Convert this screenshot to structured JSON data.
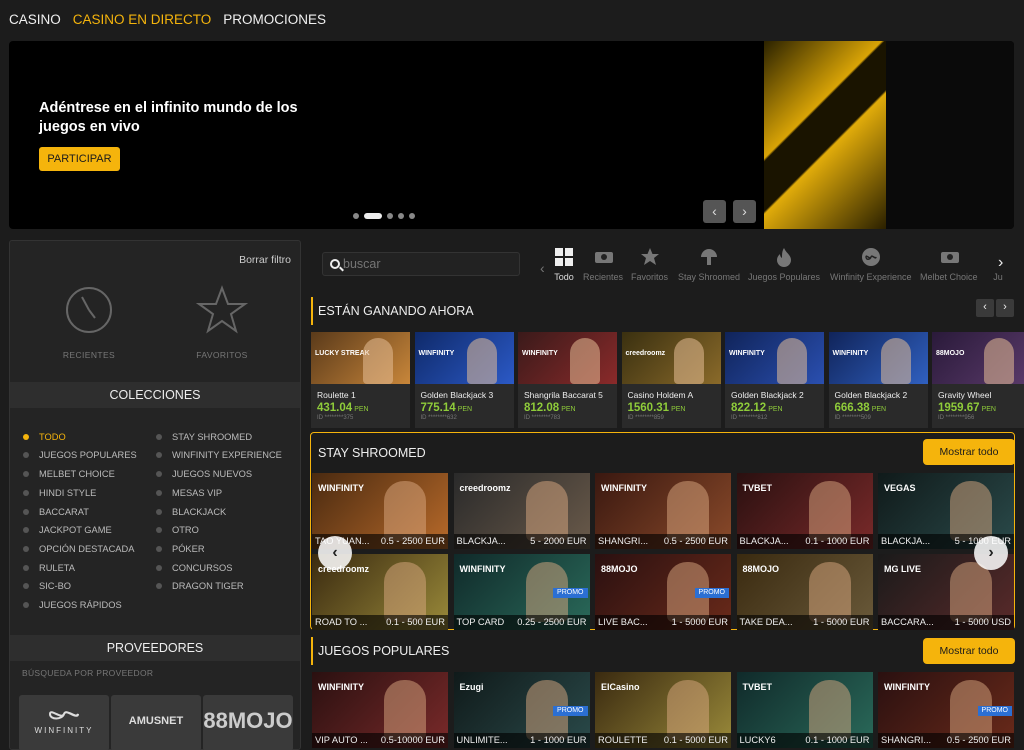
{
  "nav": [
    "CASINO",
    "CASINO EN DIRECTO",
    "PROMOCIONES"
  ],
  "hero": {
    "title": "Adéntrese en el infinito mundo de los juegos en vivo",
    "button": "PARTICIPAR"
  },
  "filters": {
    "clear": "Borrar filtro",
    "recent": "RECIENTES",
    "favorites": "FAVORITOS"
  },
  "collections": {
    "title": "COLECCIONES",
    "left": [
      "TODO",
      "JUEGOS POPULARES",
      "MELBET CHOICE",
      "HINDI STYLE",
      "BACCARAT",
      "JACKPOT GAME",
      "OPCIÓN DESTACADA",
      "RULETA",
      "SIC-BO",
      "JUEGOS RÁPIDOS"
    ],
    "right": [
      "STAY SHROOMED",
      "WINFINITY EXPERIENCE",
      "JUEGOS NUEVOS",
      "MESAS VIP",
      "BLACKJACK",
      "OTRO",
      "PÓKER",
      "CONCURSOS",
      "DRAGON TIGER"
    ]
  },
  "providers": {
    "title": "PROVEEDORES",
    "search": "BÚSQUEDA POR PROVEEDOR",
    "logos": [
      "WINFINITY",
      "AMUSNET",
      "88MOJO"
    ]
  },
  "search": {
    "placeholder": "buscar"
  },
  "categories": [
    "Todo",
    "Recientes",
    "Favoritos",
    "Stay Shroomed",
    "Juegos Populares",
    "Winfinity Experience",
    "Melbet Choice",
    "Ju"
  ],
  "winners": {
    "title": "ESTÁN GANANDO AHORA",
    "items": [
      {
        "name": "Roulette 1",
        "amount": "431.04",
        "cur": "PEN",
        "id": "ID ********375",
        "brand": "LUCKY STREAK"
      },
      {
        "name": "Golden Blackjack 3",
        "amount": "775.14",
        "cur": "PEN",
        "id": "ID ********632",
        "brand": "WINFINITY"
      },
      {
        "name": "Shangrila Baccarat 5",
        "amount": "812.08",
        "cur": "PEN",
        "id": "ID ********783",
        "brand": "WINFINITY"
      },
      {
        "name": "Casino Holdem A",
        "amount": "1560.31",
        "cur": "PEN",
        "id": "ID ********859",
        "brand": "creedroomz"
      },
      {
        "name": "Golden Blackjack 2",
        "amount": "822.12",
        "cur": "PEN",
        "id": "ID ********812",
        "brand": "WINFINITY"
      },
      {
        "name": "Golden Blackjack 2",
        "amount": "666.38",
        "cur": "PEN",
        "id": "ID ********509",
        "brand": "WINFINITY"
      },
      {
        "name": "Gravity Wheel",
        "amount": "1959.67",
        "cur": "PEN",
        "id": "ID ********956",
        "brand": "88MOJO"
      }
    ]
  },
  "stay": {
    "title": "STAY SHROOMED",
    "show_all": "Mostrar todo",
    "items": [
      {
        "name": "TAO YUAN...",
        "range": "0.5 - 2500 EUR",
        "brand": "WINFINITY",
        "badge": ""
      },
      {
        "name": "BLACKJA...",
        "range": "5 - 2000 EUR",
        "brand": "creedroomz",
        "badge": ""
      },
      {
        "name": "SHANGRI...",
        "range": "0.5 - 2500 EUR",
        "brand": "WINFINITY",
        "badge": ""
      },
      {
        "name": "BLACKJA...",
        "range": "0.1 - 1000 EUR",
        "brand": "TVBET",
        "badge": ""
      },
      {
        "name": "BLACKJA...",
        "range": "5 - 1000 EUR",
        "brand": "VEGAS",
        "badge": ""
      },
      {
        "name": "ROAD TO ...",
        "range": "0.1 - 500 EUR",
        "brand": "creedroomz",
        "badge": ""
      },
      {
        "name": "TOP CARD",
        "range": "0.25 - 2500 EUR",
        "brand": "WINFINITY",
        "badge": "PROMO"
      },
      {
        "name": "LIVE BAC...",
        "range": "1 - 5000 EUR",
        "brand": "88MOJO",
        "badge": "PROMO"
      },
      {
        "name": "TAKE DEA...",
        "range": "1 - 5000 EUR",
        "brand": "88MOJO",
        "badge": ""
      },
      {
        "name": "BACCARA...",
        "range": "1 - 5000 USD",
        "brand": "MG LIVE",
        "badge": ""
      }
    ]
  },
  "popular": {
    "title": "JUEGOS POPULARES",
    "show_all": "Mostrar todo",
    "items": [
      {
        "name": "VIP AUTO ...",
        "range": "0.5-10000 EUR",
        "brand": "WINFINITY",
        "badge": ""
      },
      {
        "name": "UNLIMITE...",
        "range": "1 - 1000 EUR",
        "brand": "Ezugi",
        "badge": "PROMO"
      },
      {
        "name": "ROULETTE",
        "range": "0.1 - 5000 EUR",
        "brand": "ElCasino",
        "badge": ""
      },
      {
        "name": "LUCKY6",
        "range": "0.1 - 1000 EUR",
        "brand": "TVBET",
        "badge": ""
      },
      {
        "name": "SHANGRI...",
        "range": "0.5 - 2500 EUR",
        "brand": "WINFINITY",
        "badge": "PROMO"
      }
    ]
  },
  "colors": {
    "accent": "#f5b40c",
    "win": "#8fcc3a",
    "bg": "#1c1c1c"
  }
}
